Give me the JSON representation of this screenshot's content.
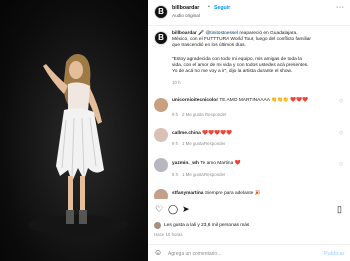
{
  "post": {
    "username": "billboardar",
    "audio": "Audio original",
    "follow_label": "Seguir",
    "more_icon": "more-icon",
    "caption": {
      "username": "billboardar",
      "mention": "@tinitostoessel",
      "line1": "reapareció en Guadalajara,",
      "line2": "México, con el FUTTTURA World Tour, luego del conflicto familiar",
      "line3": "que trascendió en los últimos días.",
      "quote1": "“Estoy agradecida con todo mi equipo, mis amigas de toda la",
      "quote2": "vida, con el amor de mi vida y con todos ustedes acá presentes.",
      "quote3": "Yo de acá no me voy a ir”, dijo la artista durante el show.",
      "time": "10 h"
    }
  },
  "comments": [
    {
      "username": "unicornioitecnicolor",
      "text": "TE AMO MARTINAAAA 👏👏👏 ❤️❤️❤️",
      "extra": "",
      "time": "10 h",
      "likes": "",
      "reply": "Responder"
    },
    {
      "username": "callme.china",
      "text": "❤️❤️❤️❤️❤️",
      "time": "9 h",
      "likes": "1 Me gusta",
      "reply": "Responder"
    },
    {
      "username": "yazmin._wh",
      "text": "Te amo Martina ❤️",
      "time": "5 h",
      "likes": "1 Me gusta",
      "reply": "Responder"
    },
    {
      "username": "stfanymartina",
      "text": "Siempre para adelante 🎉",
      "time": "",
      "likes": "",
      "reply": ""
    }
  ],
  "first_comment_time": "9 h",
  "first_comment_likes": "2 Me gusta",
  "first_comment_reply": "Responder",
  "actions": {
    "like": "heart-icon",
    "comment": "comment-icon",
    "share": "share-icon",
    "save": "bookmark-icon"
  },
  "likes_text": "Les gusta a lali y 23,6 mil personas más",
  "date": "Hace 10 horas",
  "comment_input": {
    "placeholder": "Agrega un comentario...",
    "publish": "Publicar"
  },
  "colors": {
    "accent": "#0095f6",
    "heart": "#ed4956"
  }
}
